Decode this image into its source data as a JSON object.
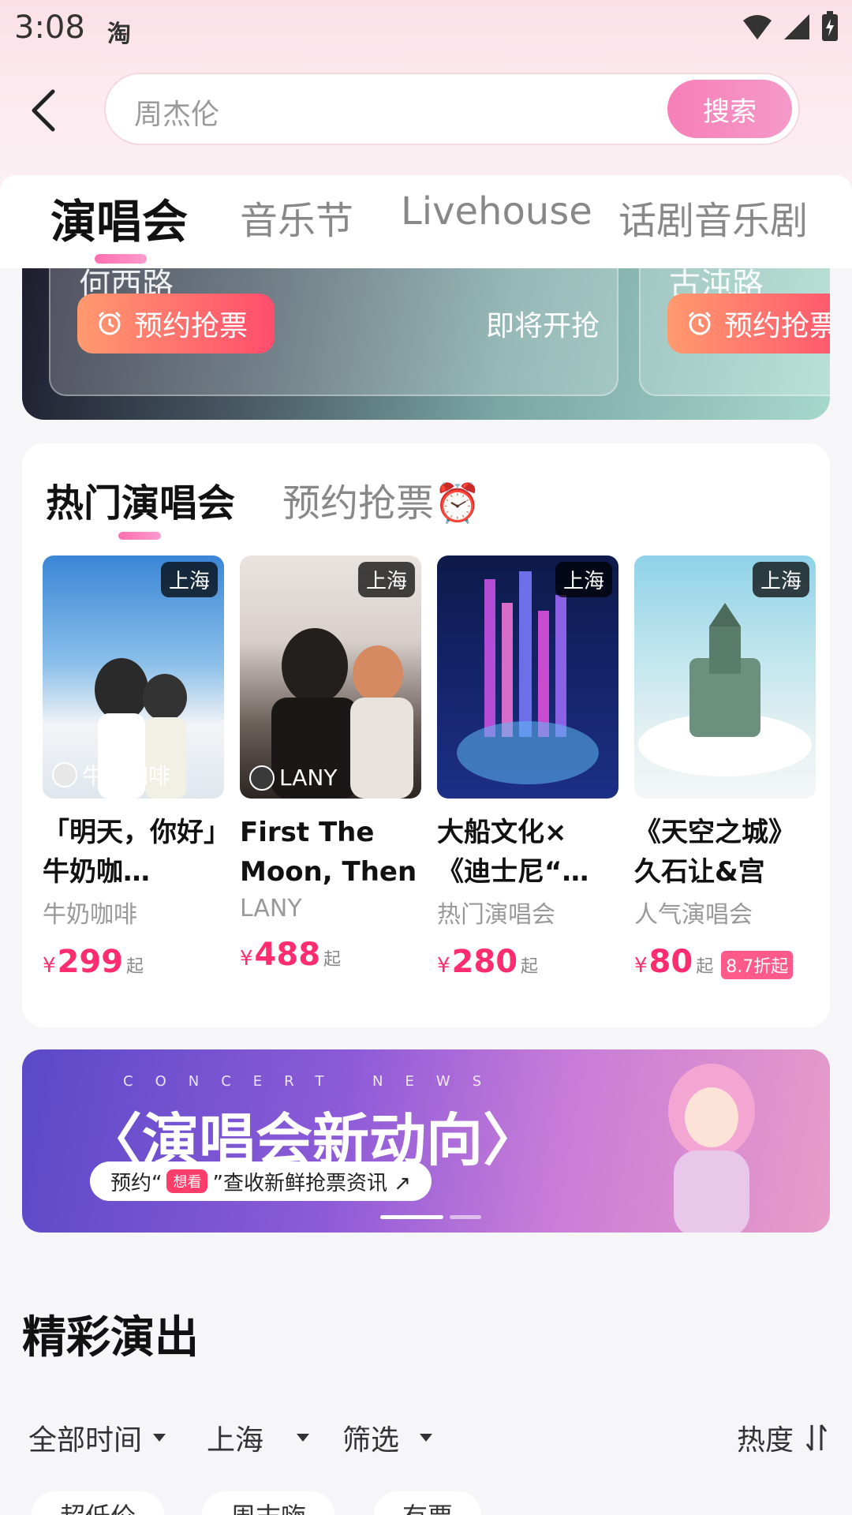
{
  "status_bar": {
    "time": "3:08",
    "app_icon_text": "淘",
    "icons": [
      "wifi-icon",
      "signal-icon",
      "battery-charging-icon"
    ]
  },
  "search": {
    "placeholder": "周杰伦",
    "button_label": "搜索"
  },
  "tabs": [
    {
      "label": "演唱会",
      "active": true
    },
    {
      "label": "音乐节",
      "active": false
    },
    {
      "label": "Livehouse",
      "active": false
    },
    {
      "label": "话剧音乐剧",
      "active": false
    }
  ],
  "presale": {
    "cards": [
      {
        "title_fragment": "何西路",
        "button_label": "预约抢票",
        "status": "即将开抢"
      },
      {
        "title_fragment": "古沌路",
        "button_label": "预约抢票"
      }
    ]
  },
  "hot": {
    "tabs": [
      {
        "label": "热门演唱会",
        "active": true
      },
      {
        "label": "预约抢票⏰",
        "active": false
      }
    ],
    "items": [
      {
        "city": "上海",
        "artist_chip": "牛奶咖啡",
        "title": "「明天，你好」牛奶咖…",
        "subtitle": "牛奶咖啡",
        "currency": "¥",
        "price": "299",
        "suffix": "起",
        "discount": ""
      },
      {
        "city": "上海",
        "artist_chip": "LANY",
        "title": "First The Moon, Then …",
        "subtitle": "LANY",
        "currency": "¥",
        "price": "488",
        "suffix": "起",
        "discount": ""
      },
      {
        "city": "上海",
        "artist_chip": "",
        "title": "大船文化×《迪士尼“…",
        "subtitle": "热门演唱会",
        "currency": "¥",
        "price": "280",
        "suffix": "起",
        "discount": ""
      },
      {
        "city": "上海",
        "artist_chip": "",
        "title": "《天空之城》久石让&宫崎…",
        "subtitle": "人气演唱会",
        "currency": "¥",
        "price": "80",
        "suffix": "起",
        "discount": "8.7折起"
      }
    ]
  },
  "news_banner": {
    "english": "CONCERT NEWS",
    "title": "〈演唱会新动向〉",
    "pill_prefix": "预约“",
    "pill_hot": "想看",
    "pill_suffix": "”查收新鲜抢票资讯 ↗"
  },
  "section": {
    "title": "精彩演出",
    "filters": {
      "time": "全部时间",
      "city": "上海",
      "filter": "筛选",
      "sort": "热度"
    },
    "chips": [
      "超低价",
      "周末嗨",
      "有票"
    ]
  }
}
